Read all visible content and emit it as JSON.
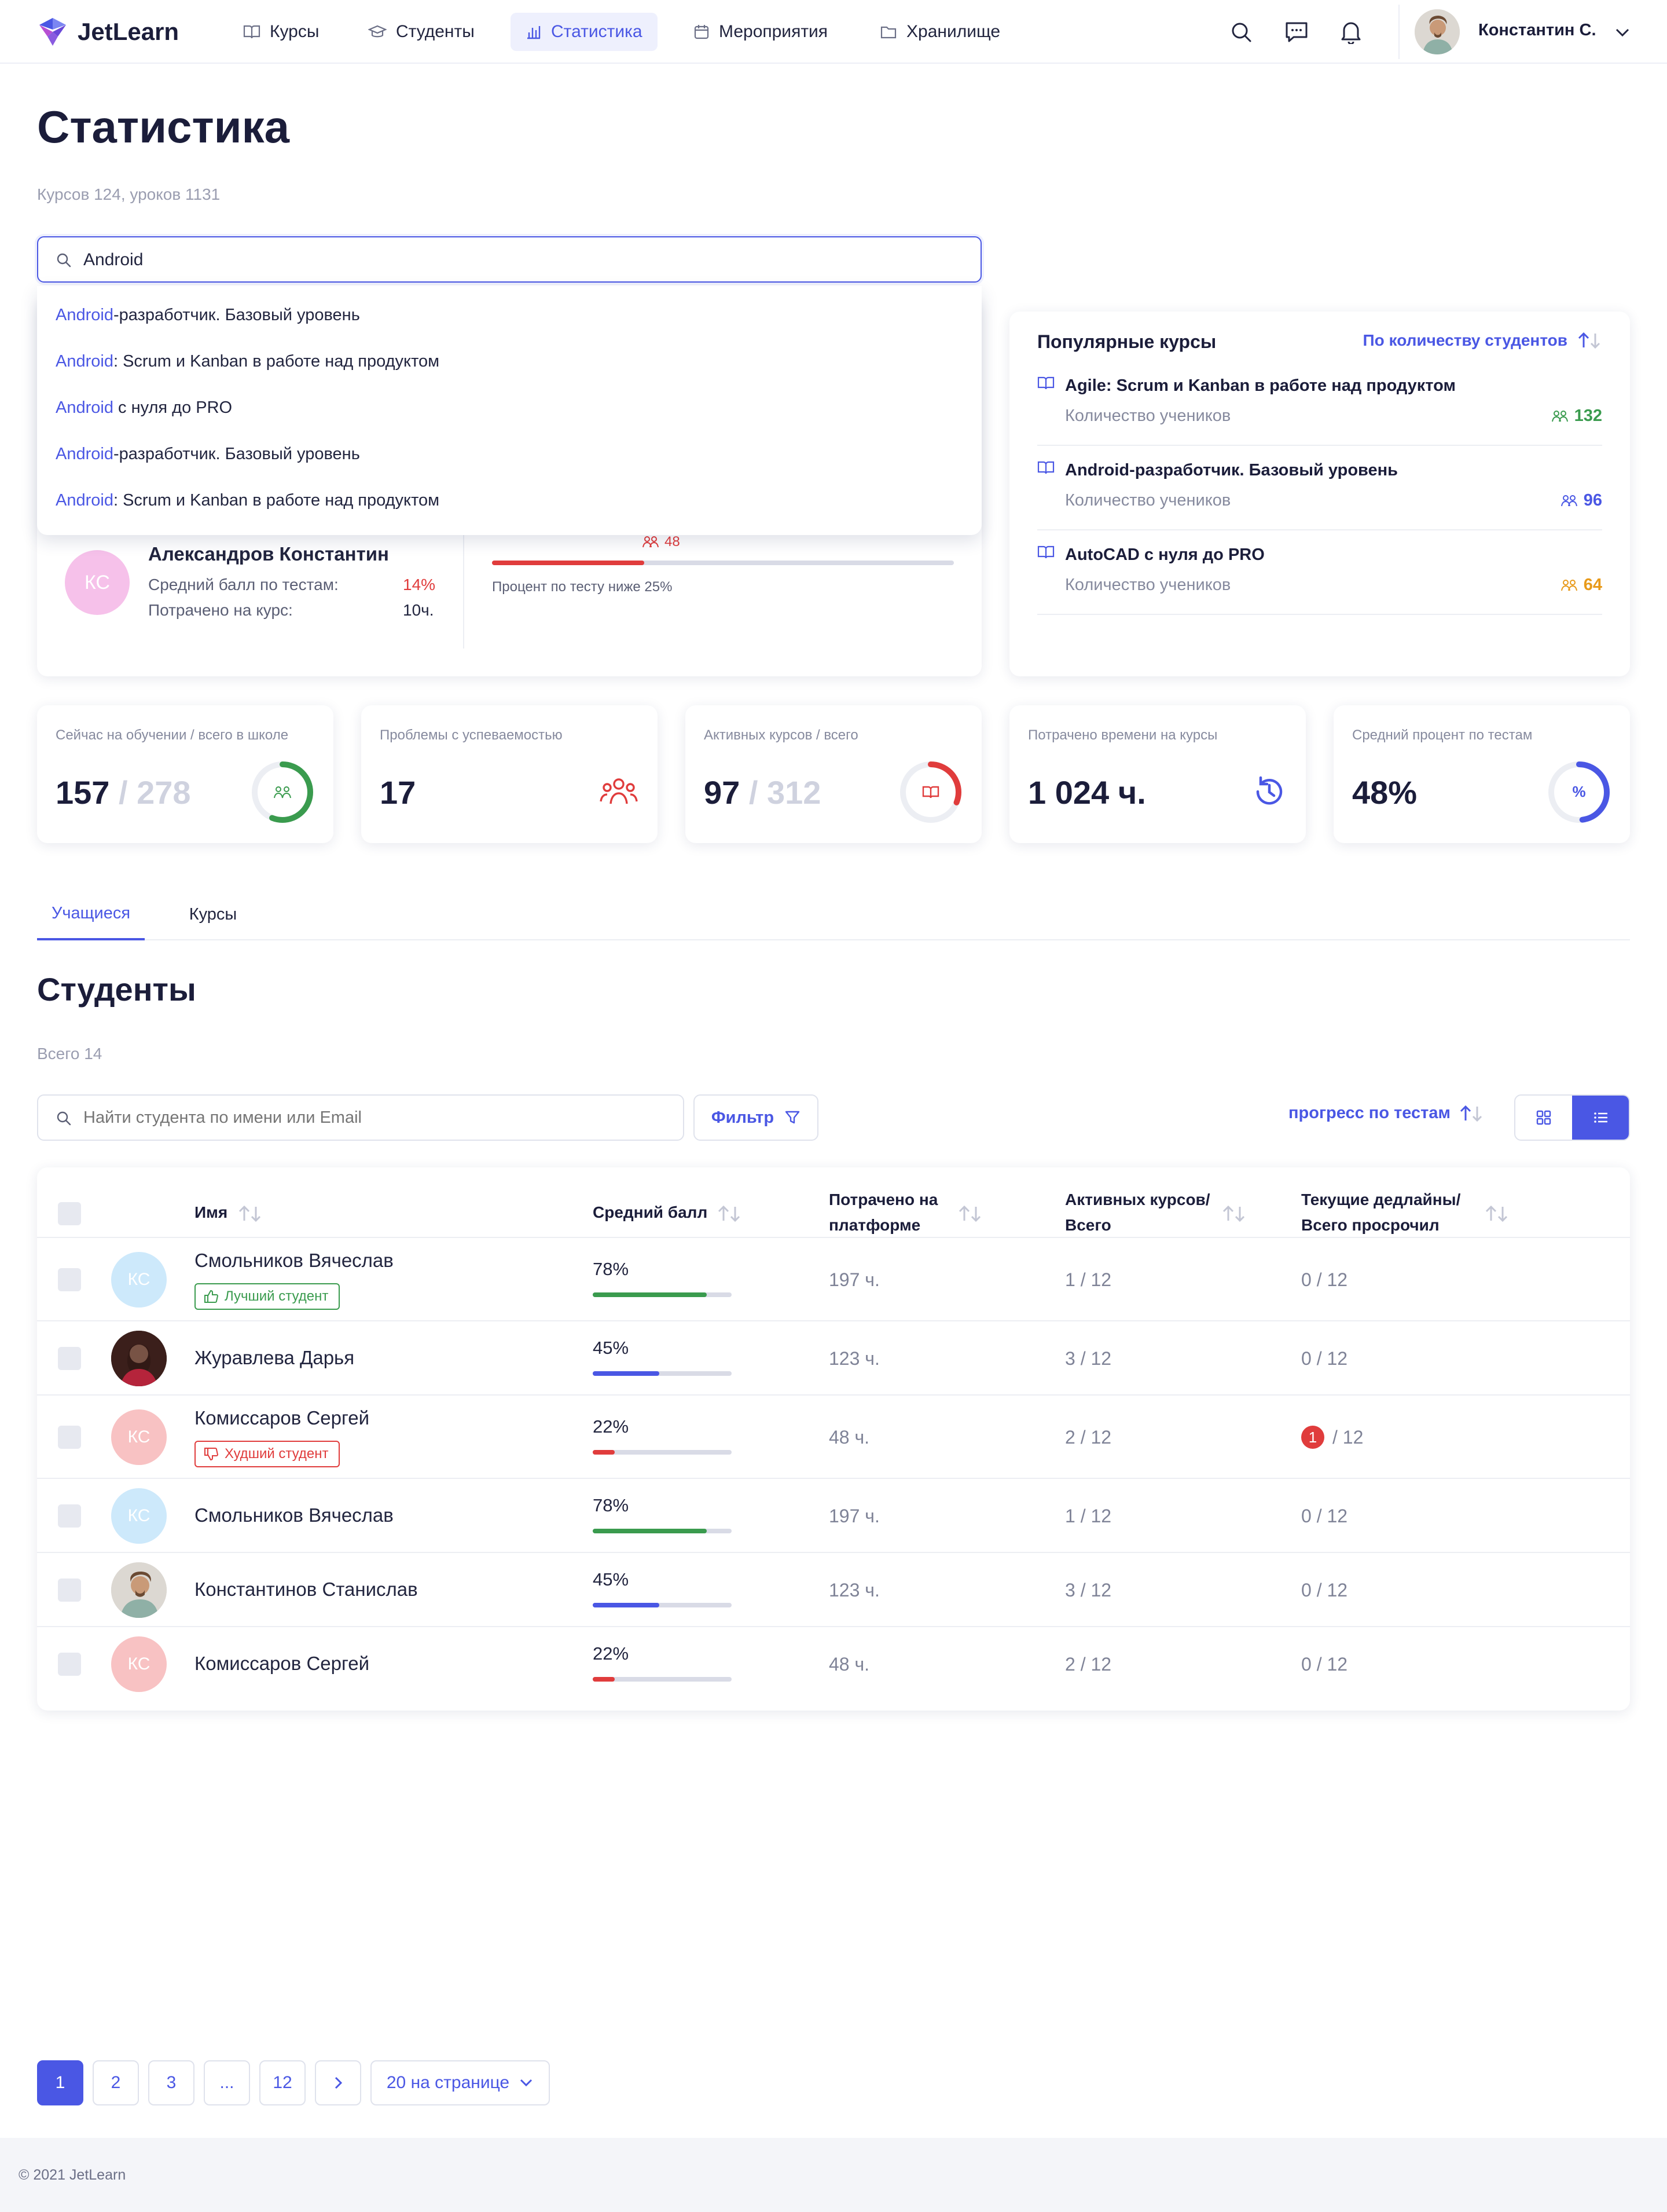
{
  "header": {
    "logo_text": "JetLearn",
    "nav": [
      {
        "label": "Курсы",
        "icon": "book-icon"
      },
      {
        "label": "Студенты",
        "icon": "graduation-cap-icon"
      },
      {
        "label": "Статистика",
        "icon": "bar-chart-icon",
        "active": true
      },
      {
        "label": "Мероприятия",
        "icon": "calendar-icon"
      },
      {
        "label": "Хранилище",
        "icon": "folder-icon"
      }
    ],
    "user_name": "Константин С."
  },
  "page": {
    "title": "Статистика",
    "subtitle": "Курсов 124, уроков 1131"
  },
  "search": {
    "value": "Android",
    "suggestions": [
      {
        "hl": "Android",
        "rest": "-разработчик. Базовый уровень"
      },
      {
        "hl": "Android",
        "rest": ": Scrum и Kanban в работе над продуктом"
      },
      {
        "hl": "Android",
        "rest": " с нуля до PRO"
      },
      {
        "hl": "Android",
        "rest": "-разработчик. Базовый уровень"
      },
      {
        "hl": "Android",
        "rest": ": Scrum и Kanban в работе над продуктом"
      }
    ]
  },
  "student_card": {
    "initials": "КС",
    "name": "Александров Константин",
    "score_label": "Средний балл по тестам:",
    "score_value": "14%",
    "time_label": "Потрачено на курс:",
    "time_value": "10ч.",
    "students_count": "48",
    "progress_caption": "Процент по тесту ниже 25%",
    "progress_fraction": 0.33
  },
  "popular": {
    "title": "Популярные курсы",
    "sort_label": "По количеству студентов",
    "count_label": "Количество учеников",
    "items": [
      {
        "title": "Agile: Scrum и Kanban в работе над продуктом",
        "count": "132",
        "color": "#3a9b4e"
      },
      {
        "title": "Android-разработчик. Базовый уровень",
        "count": "96",
        "color": "#4a57e4"
      },
      {
        "title": "AutoCAD с нуля до PRO",
        "count": "64",
        "color": "#e89a1a"
      }
    ]
  },
  "stats": [
    {
      "label": "Сейчас на обучении / всего в школе",
      "value": "157",
      "total": "/ 278",
      "icon": "students-icon",
      "fraction": 0.56,
      "color": "#3a9b4e"
    },
    {
      "label": "Проблемы с успеваемостью",
      "value": "17",
      "icon": "users-problem-icon",
      "color": "#e03c3c"
    },
    {
      "label": "Активных курсов / всего",
      "value": "97",
      "total": "/ 312",
      "icon": "book-icon",
      "fraction": 0.31,
      "color": "#e03c3c"
    },
    {
      "label": "Потрачено времени на курсы",
      "value": "1 024 ч.",
      "icon": "history-icon",
      "color": "#4a57e4"
    },
    {
      "label": "Средний процент по тестам",
      "value": "48%",
      "icon": "percent-icon",
      "fraction": 0.48,
      "color": "#4a57e4"
    }
  ],
  "tabs": [
    {
      "label": "Учащиеся",
      "active": true
    },
    {
      "label": "Курсы",
      "active": false
    }
  ],
  "students": {
    "title": "Студенты",
    "total": "Всего 14",
    "search_placeholder": "Найти студента по имени или Email",
    "filter_label": "Фильтр",
    "sort_label": "прогресс по тестам",
    "columns": {
      "name": "Имя",
      "score": "Средний балл",
      "time_1": "Потрачено на",
      "time_2": "платформе",
      "courses_1": "Активных курсов/",
      "courses_2": "Всего",
      "deadlines_1": "Текущие дедлайны/",
      "deadlines_2": "Всего просрочил"
    },
    "rows": [
      {
        "name": "Смольников Вячеслав",
        "initials": "КС",
        "avatar": "initials-blue",
        "badge": "Лучший студент",
        "badge_type": "best",
        "score": "78%",
        "score_fraction": 0.82,
        "score_color": "#3a9b4e",
        "time": "197 ч.",
        "courses": "1 / 12",
        "deadlines": "0 / 12"
      },
      {
        "name": "Журавлева Дарья",
        "initials": "",
        "avatar": "photo-woman",
        "score": "45%",
        "score_fraction": 0.48,
        "score_color": "#4a57e4",
        "time": "123 ч.",
        "courses": "3 / 12",
        "deadlines": "0 / 12"
      },
      {
        "name": "Комиссаров Сергей",
        "initials": "КС",
        "avatar": "initials-red",
        "badge": "Худший студент",
        "badge_type": "worst",
        "score": "22%",
        "score_fraction": 0.16,
        "score_color": "#e03c3c",
        "time": "48 ч.",
        "courses": "2 / 12",
        "deadlines": "/ 12",
        "overdue": "1"
      },
      {
        "name": "Смольников Вячеслав",
        "initials": "КС",
        "avatar": "initials-blue",
        "score": "78%",
        "score_fraction": 0.82,
        "score_color": "#3a9b4e",
        "time": "197 ч.",
        "courses": "1 / 12",
        "deadlines": "0 / 12"
      },
      {
        "name": "Константинов Станислав",
        "initials": "",
        "avatar": "photo-man",
        "score": "45%",
        "score_fraction": 0.48,
        "score_color": "#4a57e4",
        "time": "123 ч.",
        "courses": "3 / 12",
        "deadlines": "0 / 12"
      },
      {
        "name": "Комиссаров Сергей",
        "initials": "КС",
        "avatar": "initials-red",
        "score": "22%",
        "score_fraction": 0.16,
        "score_color": "#e03c3c",
        "time": "48 ч.",
        "courses": "2 / 12",
        "deadlines": "0 / 12"
      }
    ]
  },
  "pagination": {
    "pages": [
      "1",
      "2",
      "3",
      "...",
      "12"
    ],
    "current": "1",
    "per_page": "20 на странице"
  },
  "footer": {
    "text": "© 2021 JetLearn"
  }
}
